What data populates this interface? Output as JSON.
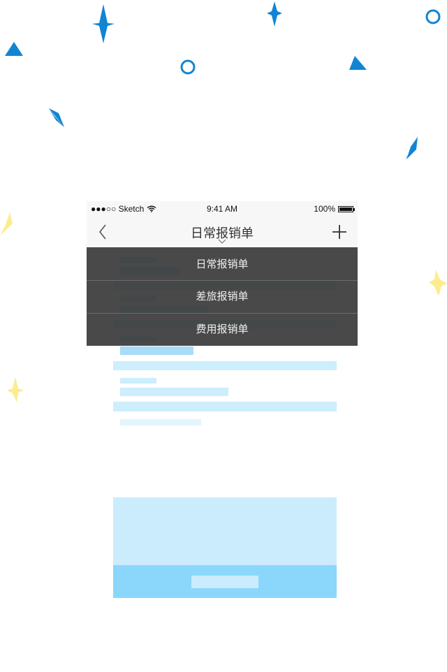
{
  "status_bar": {
    "carrier": "●●●○○ Sketch",
    "time": "9:41 AM",
    "battery": "100%"
  },
  "nav_bar": {
    "title": "日常报销单"
  },
  "dropdown": {
    "items": [
      {
        "label": "日常报销单"
      },
      {
        "label": "差旅报销单"
      },
      {
        "label": "费用报销单"
      }
    ]
  },
  "icons": {
    "back": "back-chevron-icon",
    "add": "plus-icon",
    "expand": "chevron-down-icon",
    "wifi": "wifi-icon",
    "battery": "battery-icon"
  },
  "colors": {
    "accent_blue": "#1185d4",
    "accent_yellow": "#fdec8f",
    "overlay": "#3a3a3a",
    "cta": "#8bd7fc"
  }
}
